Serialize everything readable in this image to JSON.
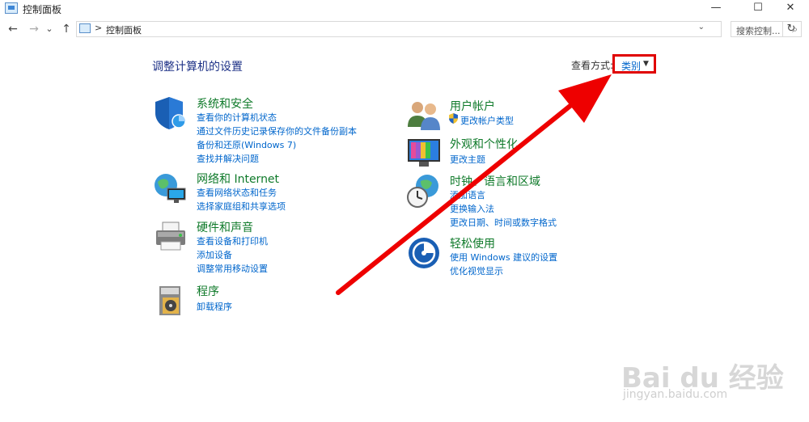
{
  "window": {
    "title": "控制面板",
    "minimize": "—",
    "maximize": "☐",
    "close": "✕"
  },
  "nav": {
    "back": "←",
    "forward": "→",
    "recent": "⌄",
    "up": "↑",
    "breadcrumb_sep": ">",
    "address_text": "控制面板",
    "address_dropdown": "⌄",
    "refresh": "↻",
    "search_placeholder": "搜索控制...",
    "search_icon": "⌕"
  },
  "main": {
    "heading": "调整计算机的设置",
    "view_by_label": "查看方式:",
    "view_by_value": "类别",
    "view_by_caret": "▼"
  },
  "categories": [
    {
      "icon": "shield-icon",
      "title": "系统和安全",
      "links": [
        "查看你的计算机状态",
        "通过文件历史记录保存你的文件备份副本",
        "备份和还原(Windows 7)",
        "查找并解决问题"
      ]
    },
    {
      "icon": "network-globe-icon",
      "title": "网络和 Internet",
      "links": [
        "查看网络状态和任务",
        "选择家庭组和共享选项"
      ]
    },
    {
      "icon": "printer-icon",
      "title": "硬件和声音",
      "links": [
        "查看设备和打印机",
        "添加设备",
        "调整常用移动设置"
      ]
    },
    {
      "icon": "programs-icon",
      "title": "程序",
      "links": [
        "卸载程序"
      ]
    },
    {
      "icon": "users-icon",
      "title": "用户帐户",
      "links": [
        "更改帐户类型"
      ]
    },
    {
      "icon": "monitor-icon",
      "title": "外观和个性化",
      "links": [
        "更改主题"
      ]
    },
    {
      "icon": "clock-globe-icon",
      "title": "时钟、语言和区域",
      "links": [
        "添加语言",
        "更换输入法",
        "更改日期、时间或数字格式"
      ]
    },
    {
      "icon": "ease-of-access-icon",
      "title": "轻松使用",
      "links": [
        "使用 Windows 建议的设置",
        "优化视觉显示"
      ]
    }
  ],
  "watermark": {
    "brand": "Bai du 经验",
    "url": "jingyan.baidu.com"
  },
  "colors": {
    "title_green": "#0f7a2a",
    "link_blue": "#0066cc",
    "heading_blue": "#1e3287",
    "highlight_red": "#e00000"
  }
}
